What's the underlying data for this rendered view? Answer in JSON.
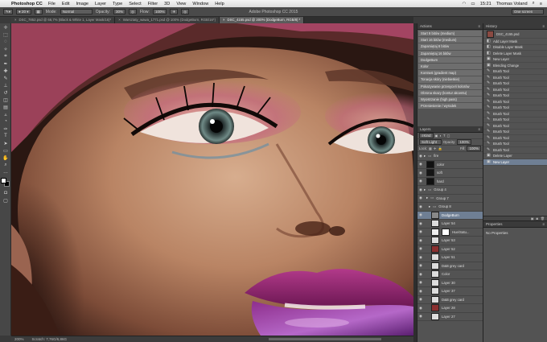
{
  "menubar": {
    "app_name": "Photoshop CC",
    "menus": [
      "File",
      "Edit",
      "Image",
      "Layer",
      "Type",
      "Select",
      "Filter",
      "3D",
      "View",
      "Window",
      "Help"
    ],
    "clock": "15:21",
    "user": "Thomas Voland"
  },
  "window": {
    "title": "Adobe Photoshop CC 2015"
  },
  "options": {
    "mode_label": "Mode:",
    "mode_value": "Normal",
    "opacity_label": "Opacity:",
    "opacity_value": "30%",
    "flow_label": "Flow:",
    "flow_value": "100%",
    "workspace": "One screen"
  },
  "tabs": [
    {
      "label": "DSC_7852.psd @ 66,7% (Black & White 1, Layer Mask/16)*"
    },
    {
      "label": "Warsztaty_wawa_1771.psd @ 100% (DodgeBurn, RGB/16*)"
    },
    {
      "label": "DSC_4155.psd @ 200% (DodgeBurn, RGB/8) *"
    }
  ],
  "status": {
    "zoom": "200%",
    "doc": "Scratch: 7,76G/6,86G"
  },
  "actions": {
    "title": "Actions",
    "items": [
      "Start 8 bitów (medium)",
      "Start 16 bitów (medium)",
      "Zapamiętaj 8 bitów",
      "Zapamiętaj 16 bitów",
      "DodgeBurn",
      "Kolor",
      "Kontrast (gradient map)",
      "Tonacja skóry (niebieskie)",
      "Pokazywanie przesyceń kolorów",
      "Obrona skazy (kontur akcentu)",
      "Wyostrzanie (high pass)",
      "Przeniesienie / wyrodek"
    ]
  },
  "history": {
    "title": "History",
    "snapshot": "DSC_4155.psd",
    "items": [
      "Add Layer Mask",
      "Disable Layer Mask",
      "Delete Layer Mask",
      "New Layer",
      "Blending Change",
      "Brush Tool",
      "Brush Tool",
      "Brush Tool",
      "Brush Tool",
      "Brush Tool",
      "Brush Tool",
      "Brush Tool",
      "Brush Tool",
      "Brush Tool",
      "Brush Tool",
      "Brush Tool",
      "Brush Tool",
      "Brush Tool",
      "Brush Tool",
      "Delete Layer",
      "New Layer"
    ],
    "selected_index": 20
  },
  "layers": {
    "title": "Layers",
    "kind_label": "Kind",
    "blend_mode": "Soft Light",
    "opacity_label": "Opacity:",
    "opacity_value": "100%",
    "lock_label": "Lock:",
    "fill_label": "Fill:",
    "fill_value": "100%",
    "items": [
      {
        "name": "fire",
        "type": "group",
        "indent": 0
      },
      {
        "name": "color",
        "type": "layer",
        "indent": 1,
        "thumb": "#111"
      },
      {
        "name": "soft",
        "type": "layer",
        "indent": 1,
        "thumb": "#151515"
      },
      {
        "name": "hard",
        "type": "layer",
        "indent": 1,
        "thumb": "#111"
      },
      {
        "name": "Group 4",
        "type": "group",
        "indent": 0
      },
      {
        "name": "Group 7",
        "type": "group",
        "indent": 1
      },
      {
        "name": "Group 8",
        "type": "group",
        "indent": 2
      },
      {
        "name": "DodgeBurn",
        "type": "layer",
        "indent": 3,
        "thumb": "#888",
        "selected": true
      },
      {
        "name": "Layer 54",
        "type": "layer",
        "indent": 3,
        "thumb": "#ddd"
      },
      {
        "name": "Hue/Satu...",
        "type": "adjust",
        "indent": 3,
        "thumb": "#eee"
      },
      {
        "name": "Layer 53",
        "type": "layer",
        "indent": 3,
        "thumb": "#ddd"
      },
      {
        "name": "Layer 52",
        "type": "layer",
        "indent": 3,
        "thumb": "#8a3030"
      },
      {
        "name": "Layer 51",
        "type": "layer",
        "indent": 3,
        "thumb": "#ddd"
      },
      {
        "name": "D&B grey card",
        "type": "layer",
        "indent": 3,
        "thumb": "#ddd"
      },
      {
        "name": "Color",
        "type": "layer",
        "indent": 3,
        "thumb": "#ddd"
      },
      {
        "name": "Layer 30",
        "type": "layer",
        "indent": 3,
        "thumb": "#ddd"
      },
      {
        "name": "Layer 37",
        "type": "layer",
        "indent": 3,
        "thumb": "#ddd"
      },
      {
        "name": "D&B grey card",
        "type": "layer",
        "indent": 3,
        "thumb": "#ddd"
      },
      {
        "name": "Layer 28",
        "type": "layer",
        "indent": 3,
        "thumb": "#8a3030"
      },
      {
        "name": "Layer 27",
        "type": "layer",
        "indent": 3,
        "thumb": "#ddd"
      }
    ]
  },
  "properties": {
    "title": "Properties",
    "body": "No Properties"
  },
  "colors": {
    "selection": "#6f7f94",
    "panel": "#535353"
  }
}
